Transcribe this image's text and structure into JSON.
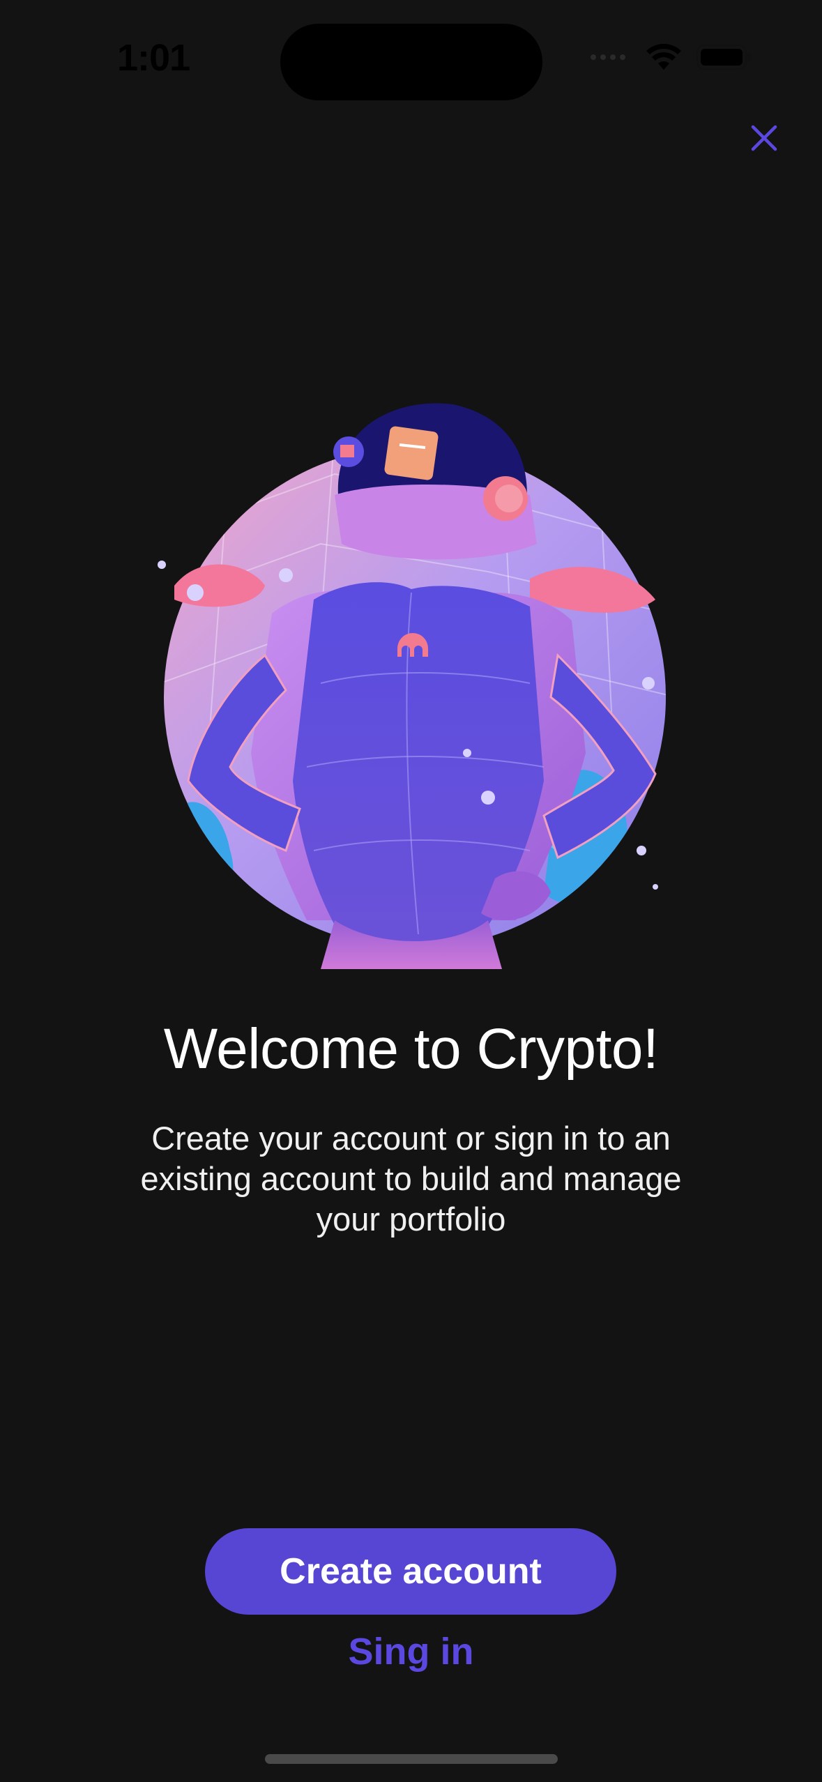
{
  "status": {
    "time": "1:01"
  },
  "icons": {
    "close": "close-icon",
    "wifi": "wifi-icon",
    "battery": "battery-icon",
    "signal": "signal-icon"
  },
  "welcome": {
    "title": "Welcome to Crypto!",
    "subtitle": "Create your account or sign in to an existing account to build and manage your portfolio"
  },
  "actions": {
    "create_label": "Create account",
    "signin_label": "Sing in"
  },
  "colors": {
    "accent": "#5745D3",
    "background": "#131313"
  }
}
